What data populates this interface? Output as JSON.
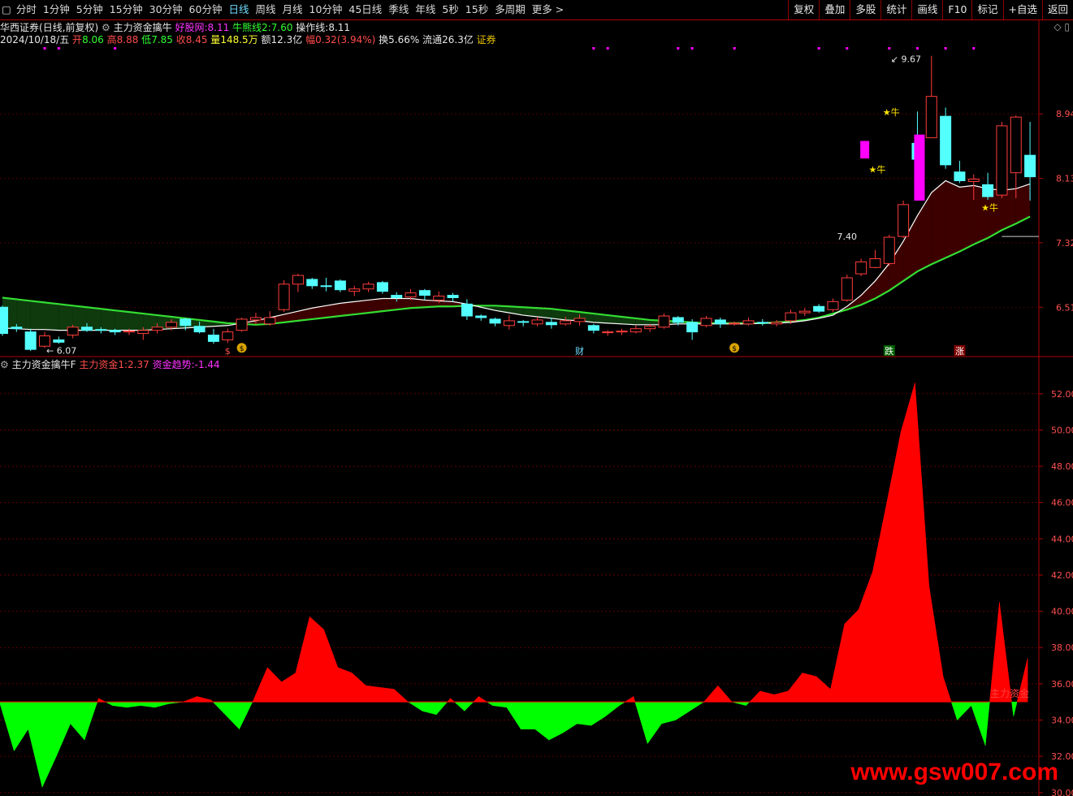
{
  "topbar": {
    "tabs": [
      "分时",
      "1分钟",
      "5分钟",
      "15分钟",
      "30分钟",
      "60分钟",
      "日线",
      "周线",
      "月线",
      "10分钟",
      "45日线",
      "季线",
      "年线",
      "5秒",
      "15秒",
      "多周期",
      "更多 >"
    ],
    "active_tab": "日线",
    "tools": [
      "复权",
      "叠加",
      "多股",
      "统计",
      "画线",
      "F10",
      "标记",
      "+自选",
      "返回"
    ]
  },
  "header": {
    "stock": "华西证券",
    "mode": "(日线,前复权)",
    "indicator": "主力资金擒牛",
    "hm_label": "好股网:",
    "hm_value": "8.11",
    "nx_label": "牛熊线2:",
    "nx_value": "7.60",
    "cz_label": "操作线:",
    "cz_value": "8.11"
  },
  "quote": {
    "date": "2024/10/18/五",
    "open_label": "开",
    "open": "8.06",
    "high_label": "高",
    "high": "8.88",
    "low_label": "低",
    "low": "7.85",
    "close_label": "收",
    "close": "8.45",
    "vol_label": "量",
    "vol": "148.5万",
    "amt_label": "额",
    "amt": "12.3亿",
    "chg_label": "幅",
    "chg": "0.32(3.94%)",
    "turn_label": "换",
    "turn": "5.66%",
    "float_label": "流通",
    "float": "26.3亿",
    "sector": "证券"
  },
  "sub_header": {
    "name": "主力资金擒牛F",
    "zl_label": "主力资金1:",
    "zl_value": "2.37",
    "qs_label": "资金趋势:",
    "qs_value": "-1.44"
  },
  "colors": {
    "up": "#ff3c3c",
    "down": "#54ffff",
    "bull_line": "#33dd33",
    "op_line": "#ffffff",
    "cloud": "#3a0000",
    "cloud_green": "#003a00",
    "magenta": "#ff00ff",
    "grid": "#7a0000"
  },
  "price_axis": {
    "labels": [
      "8.94",
      "8.13",
      "7.32",
      "6.51"
    ],
    "values": [
      8.94,
      8.13,
      7.32,
      6.51
    ],
    "min": 5.9,
    "max": 9.8
  },
  "price_labels": {
    "low_mark": "6.07",
    "high_mark": "9.67",
    "ref_mark": "7.40"
  },
  "signals": {
    "bull": "★牛",
    "money": "$",
    "cai": "财",
    "die": "跌",
    "zhang": "涨"
  },
  "candles": [
    [
      6.51,
      6.18,
      6.53,
      6.15
    ],
    [
      6.26,
      6.24,
      6.3,
      6.2
    ],
    [
      6.2,
      5.98,
      6.24,
      5.96
    ],
    [
      6.02,
      6.15,
      6.2,
      6.0
    ],
    [
      6.1,
      6.07,
      6.14,
      6.05
    ],
    [
      6.16,
      6.26,
      6.29,
      6.12
    ],
    [
      6.26,
      6.22,
      6.31,
      6.2
    ],
    [
      6.23,
      6.22,
      6.26,
      6.18
    ],
    [
      6.22,
      6.2,
      6.24,
      6.16
    ],
    [
      6.2,
      6.21,
      6.24,
      6.16
    ],
    [
      6.18,
      6.22,
      6.26,
      6.1
    ],
    [
      6.22,
      6.26,
      6.31,
      6.18
    ],
    [
      6.26,
      6.32,
      6.36,
      6.22
    ],
    [
      6.36,
      6.28,
      6.38,
      6.22
    ],
    [
      6.27,
      6.2,
      6.33,
      6.18
    ],
    [
      6.16,
      6.08,
      6.24,
      6.05
    ],
    [
      6.1,
      6.2,
      6.24,
      6.06
    ],
    [
      6.22,
      6.36,
      6.38,
      6.2
    ],
    [
      6.35,
      6.38,
      6.44,
      6.3
    ],
    [
      6.3,
      6.38,
      6.46,
      6.28
    ],
    [
      6.48,
      6.8,
      6.85,
      6.45
    ],
    [
      6.8,
      6.91,
      6.93,
      6.7
    ],
    [
      6.86,
      6.78,
      6.88,
      6.74
    ],
    [
      6.78,
      6.77,
      6.88,
      6.71
    ],
    [
      6.84,
      6.73,
      6.86,
      6.7
    ],
    [
      6.71,
      6.74,
      6.78,
      6.65
    ],
    [
      6.74,
      6.8,
      6.83,
      6.7
    ],
    [
      6.82,
      6.71,
      6.84,
      6.68
    ],
    [
      6.66,
      6.63,
      6.7,
      6.58
    ],
    [
      6.64,
      6.69,
      6.74,
      6.6
    ],
    [
      6.72,
      6.66,
      6.74,
      6.6
    ],
    [
      6.6,
      6.65,
      6.71,
      6.56
    ],
    [
      6.66,
      6.63,
      6.69,
      6.58
    ],
    [
      6.55,
      6.4,
      6.61,
      6.35
    ],
    [
      6.4,
      6.38,
      6.42,
      6.34
    ],
    [
      6.36,
      6.31,
      6.38,
      6.27
    ],
    [
      6.28,
      6.34,
      6.41,
      6.23
    ],
    [
      6.33,
      6.32,
      6.35,
      6.27
    ],
    [
      6.3,
      6.35,
      6.39,
      6.27
    ],
    [
      6.32,
      6.29,
      6.38,
      6.24
    ],
    [
      6.3,
      6.34,
      6.39,
      6.28
    ],
    [
      6.33,
      6.37,
      6.42,
      6.28
    ],
    [
      6.28,
      6.22,
      6.3,
      6.18
    ],
    [
      6.2,
      6.2,
      6.22,
      6.15
    ],
    [
      6.2,
      6.21,
      6.24,
      6.16
    ],
    [
      6.2,
      6.24,
      6.28,
      6.18
    ],
    [
      6.24,
      6.27,
      6.3,
      6.2
    ],
    [
      6.26,
      6.4,
      6.43,
      6.24
    ],
    [
      6.38,
      6.32,
      6.4,
      6.28
    ],
    [
      6.32,
      6.2,
      6.36,
      6.1
    ],
    [
      6.28,
      6.37,
      6.4,
      6.26
    ],
    [
      6.35,
      6.3,
      6.38,
      6.25
    ],
    [
      6.3,
      6.31,
      6.33,
      6.28
    ],
    [
      6.3,
      6.34,
      6.38,
      6.28
    ],
    [
      6.32,
      6.31,
      6.36,
      6.28
    ],
    [
      6.3,
      6.32,
      6.35,
      6.27
    ],
    [
      6.34,
      6.44,
      6.48,
      6.3
    ],
    [
      6.44,
      6.46,
      6.5,
      6.4
    ],
    [
      6.52,
      6.46,
      6.55,
      6.44
    ],
    [
      6.48,
      6.58,
      6.62,
      6.45
    ],
    [
      6.6,
      6.88,
      6.92,
      6.58
    ],
    [
      6.93,
      7.08,
      7.12,
      6.9
    ],
    [
      7.01,
      7.12,
      7.23,
      7.0
    ],
    [
      7.06,
      7.39,
      7.42,
      7.03
    ],
    [
      7.4,
      7.8,
      7.85,
      7.38
    ],
    [
      8.57,
      8.37,
      8.97,
      8.13
    ],
    [
      8.64,
      9.16,
      9.67,
      8.65
    ],
    [
      8.91,
      8.3,
      9.02,
      8.25
    ],
    [
      8.21,
      8.1,
      8.35,
      8.07
    ],
    [
      8.09,
      8.12,
      8.18,
      7.86
    ],
    [
      8.05,
      7.9,
      8.2,
      7.86
    ],
    [
      7.92,
      8.79,
      8.84,
      7.88
    ],
    [
      8.2,
      8.9,
      8.92,
      7.88
    ],
    [
      8.42,
      8.15,
      8.84,
      7.85
    ]
  ],
  "ma_op": [
    6.25,
    6.24,
    6.23,
    6.23,
    6.22,
    6.22,
    6.22,
    6.22,
    6.22,
    6.22,
    6.22,
    6.23,
    6.24,
    6.25,
    6.26,
    6.27,
    6.28,
    6.31,
    6.34,
    6.38,
    6.42,
    6.46,
    6.5,
    6.53,
    6.56,
    6.58,
    6.6,
    6.62,
    6.62,
    6.62,
    6.6,
    6.59,
    6.58,
    6.55,
    6.51,
    6.47,
    6.44,
    6.41,
    6.39,
    6.37,
    6.35,
    6.34,
    6.32,
    6.31,
    6.3,
    6.29,
    6.29,
    6.29,
    6.3,
    6.3,
    6.3,
    6.3,
    6.3,
    6.3,
    6.31,
    6.31,
    6.32,
    6.34,
    6.37,
    6.41,
    6.52,
    6.66,
    6.84,
    7.06,
    7.34,
    7.66,
    7.95,
    8.1,
    8.02,
    8.04,
    8.0,
    7.98,
    8.0,
    8.06
  ],
  "ma_bull": [
    6.63,
    6.61,
    6.59,
    6.57,
    6.55,
    6.53,
    6.51,
    6.49,
    6.47,
    6.45,
    6.43,
    6.41,
    6.39,
    6.37,
    6.35,
    6.33,
    6.31,
    6.3,
    6.29,
    6.3,
    6.32,
    6.34,
    6.36,
    6.38,
    6.4,
    6.42,
    6.44,
    6.46,
    6.48,
    6.5,
    6.51,
    6.52,
    6.52,
    6.53,
    6.53,
    6.53,
    6.52,
    6.51,
    6.5,
    6.49,
    6.47,
    6.45,
    6.43,
    6.41,
    6.39,
    6.37,
    6.35,
    6.34,
    6.33,
    6.32,
    6.31,
    6.31,
    6.31,
    6.31,
    6.31,
    6.32,
    6.33,
    6.35,
    6.38,
    6.43,
    6.48,
    6.54,
    6.62,
    6.72,
    6.84,
    6.96,
    7.05,
    7.13,
    7.21,
    7.3,
    7.38,
    7.48,
    7.56,
    7.65
  ],
  "sub_axis": {
    "labels": [
      "52.00",
      "50.00",
      "48.00",
      "46.00",
      "44.00",
      "42.00",
      "40.00",
      "38.00",
      "36.00",
      "34.00",
      "32.00",
      "30.00"
    ],
    "min": 29.9,
    "max": 53.2,
    "baseline": 35
  },
  "sub_line_label": "主力资金",
  "sub_series": [
    34.9,
    32.3,
    33.5,
    30.3,
    32.0,
    33.8,
    32.9,
    35.2,
    34.8,
    34.7,
    34.8,
    34.7,
    34.9,
    35.0,
    35.3,
    35.1,
    34.3,
    33.5,
    35.1,
    36.9,
    36.1,
    36.6,
    39.7,
    39.0,
    36.9,
    36.6,
    35.9,
    35.8,
    35.7,
    35.0,
    34.5,
    34.3,
    35.2,
    34.5,
    35.3,
    34.8,
    34.7,
    33.5,
    33.5,
    32.9,
    33.3,
    33.8,
    33.7,
    34.2,
    34.8,
    35.3,
    32.7,
    33.8,
    34.0,
    34.5,
    35.0,
    35.9,
    35.0,
    34.8,
    35.6,
    35.4,
    35.6,
    36.6,
    36.4,
    35.7,
    39.3,
    40.1,
    42.2,
    46.0,
    49.9,
    52.6,
    41.4,
    36.4,
    34.0,
    34.8,
    32.6,
    40.5,
    34.2,
    37.4
  ],
  "watermark": "www.gsw007.com"
}
